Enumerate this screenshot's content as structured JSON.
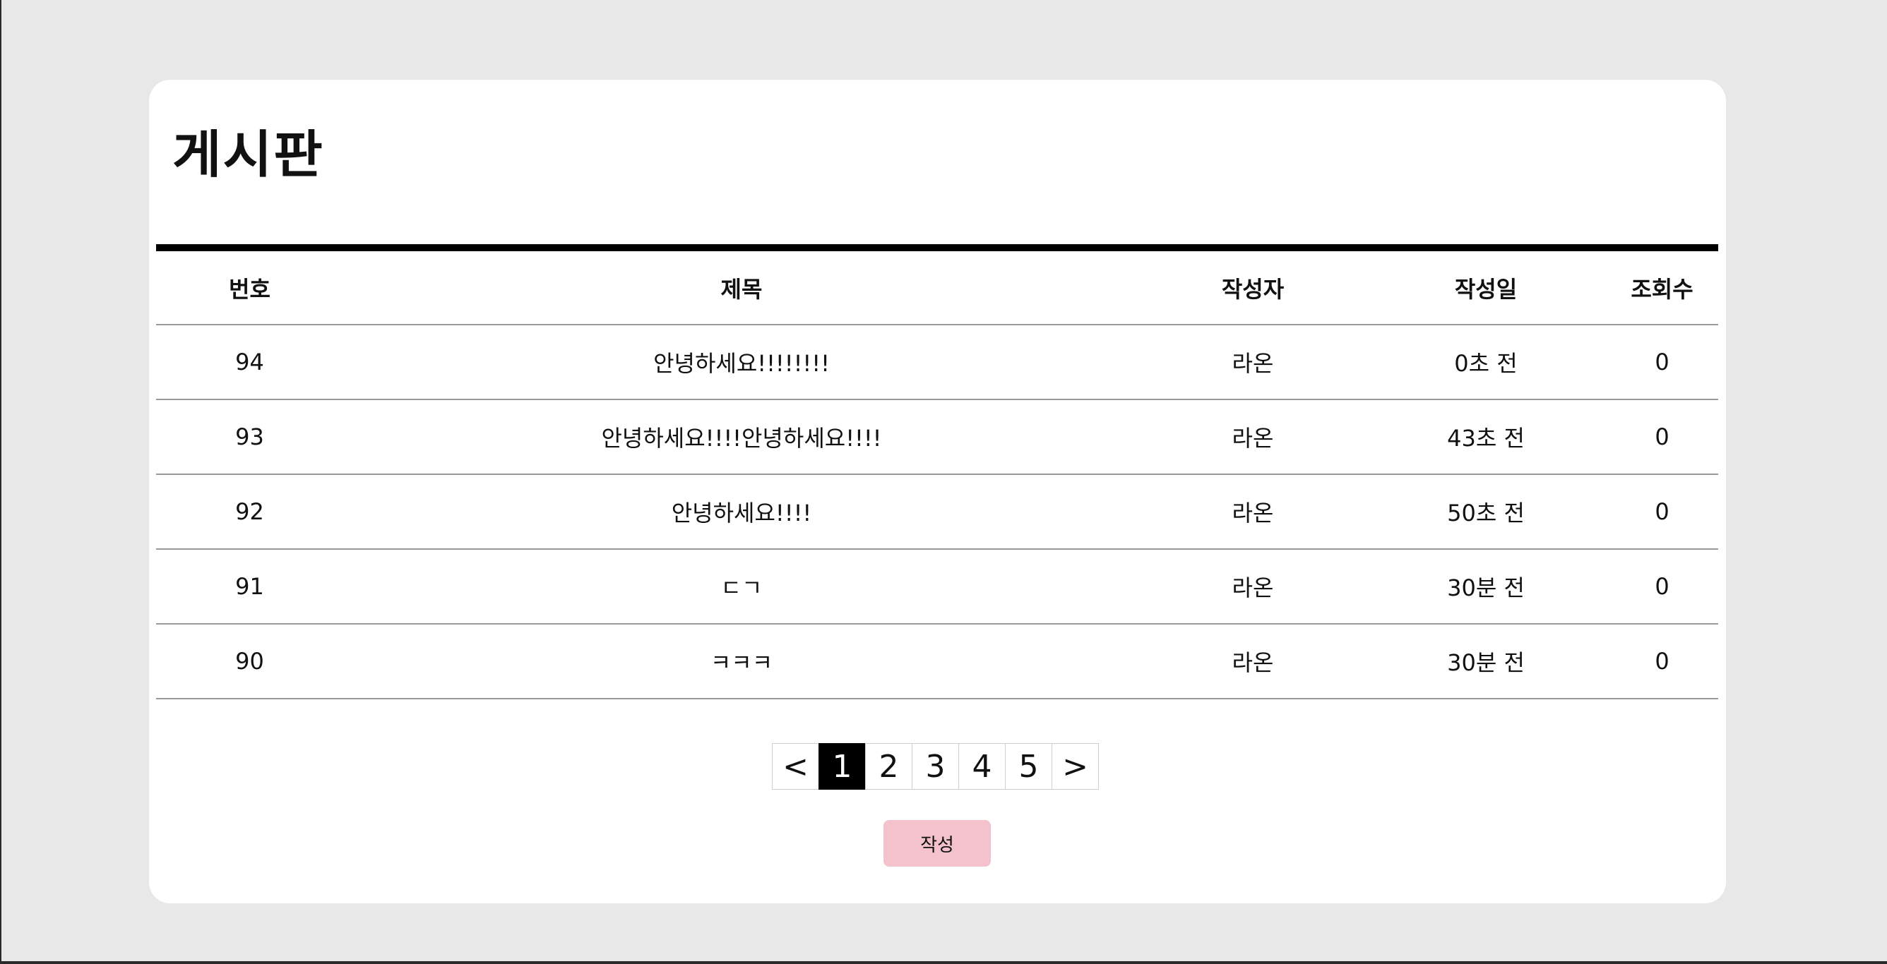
{
  "board": {
    "title": "게시판",
    "columns": [
      "번호",
      "제목",
      "작성자",
      "작성일",
      "조회수"
    ],
    "rows": [
      [
        "94",
        "안녕하세요!!!!!!!!",
        "라온",
        "0초 전",
        "0"
      ],
      [
        "93",
        "안녕하세요!!!!안녕하세요!!!!",
        "라온",
        "43초 전",
        "0"
      ],
      [
        "92",
        "안녕하세요!!!!",
        "라온",
        "50초 전",
        "0"
      ],
      [
        "91",
        "ㄷㄱ",
        "라온",
        "30분 전",
        "0"
      ],
      [
        "90",
        "ㅋㅋㅋ",
        "라온",
        "30분 전",
        "0"
      ]
    ]
  },
  "pagination": {
    "prev": "<",
    "pages": [
      "1",
      "2",
      "3",
      "4",
      "5"
    ],
    "next": ">",
    "current": "1"
  },
  "actions": {
    "write_label": "작성"
  },
  "colors": {
    "background": "#e8e8e8",
    "card": "#ffffff",
    "write_button": "#f4c2cc",
    "active_page": "#000000"
  }
}
